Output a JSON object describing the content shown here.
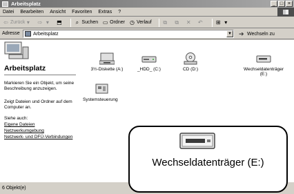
{
  "window": {
    "title": "Arbeitsplatz"
  },
  "menu": [
    "Datei",
    "Bearbeiten",
    "Ansicht",
    "Favoriten",
    "Extras",
    "?"
  ],
  "toolbar": {
    "back": "Zurück",
    "search": "Suchen",
    "folders": "Ordner",
    "history": "Verlauf"
  },
  "address": {
    "label": "Adresse",
    "value": "Arbeitsplatz",
    "go": "Wechseln zu"
  },
  "sidebar": {
    "heading": "Arbeitsplatz",
    "hint": "Markieren Sie ein Objekt, um seine Beschreibung anzuzeigen.",
    "info": "Zeigt Dateien und Ordner auf dem Computer an.",
    "see_also": "Siehe auch:",
    "links": [
      "Eigene Dateien",
      "Netzwerkumgebung",
      "Netzwerk- und DFÜ-Verbindungen"
    ]
  },
  "items": [
    {
      "label": "3½-Diskette (A:)",
      "icon": "floppy-drive-icon"
    },
    {
      "label": "_HDD_ (C:)",
      "icon": "hard-drive-icon"
    },
    {
      "label": "CD (D:)",
      "icon": "cd-drive-icon"
    },
    {
      "label": "Wechseldatenträger (E:)",
      "icon": "removable-drive-icon"
    },
    {
      "label": "Systemsteuerung",
      "icon": "control-panel-icon"
    }
  ],
  "status": {
    "text": "6 Objekt(e)"
  },
  "zoom": {
    "label": "Wechseldatenträger (E:)"
  }
}
